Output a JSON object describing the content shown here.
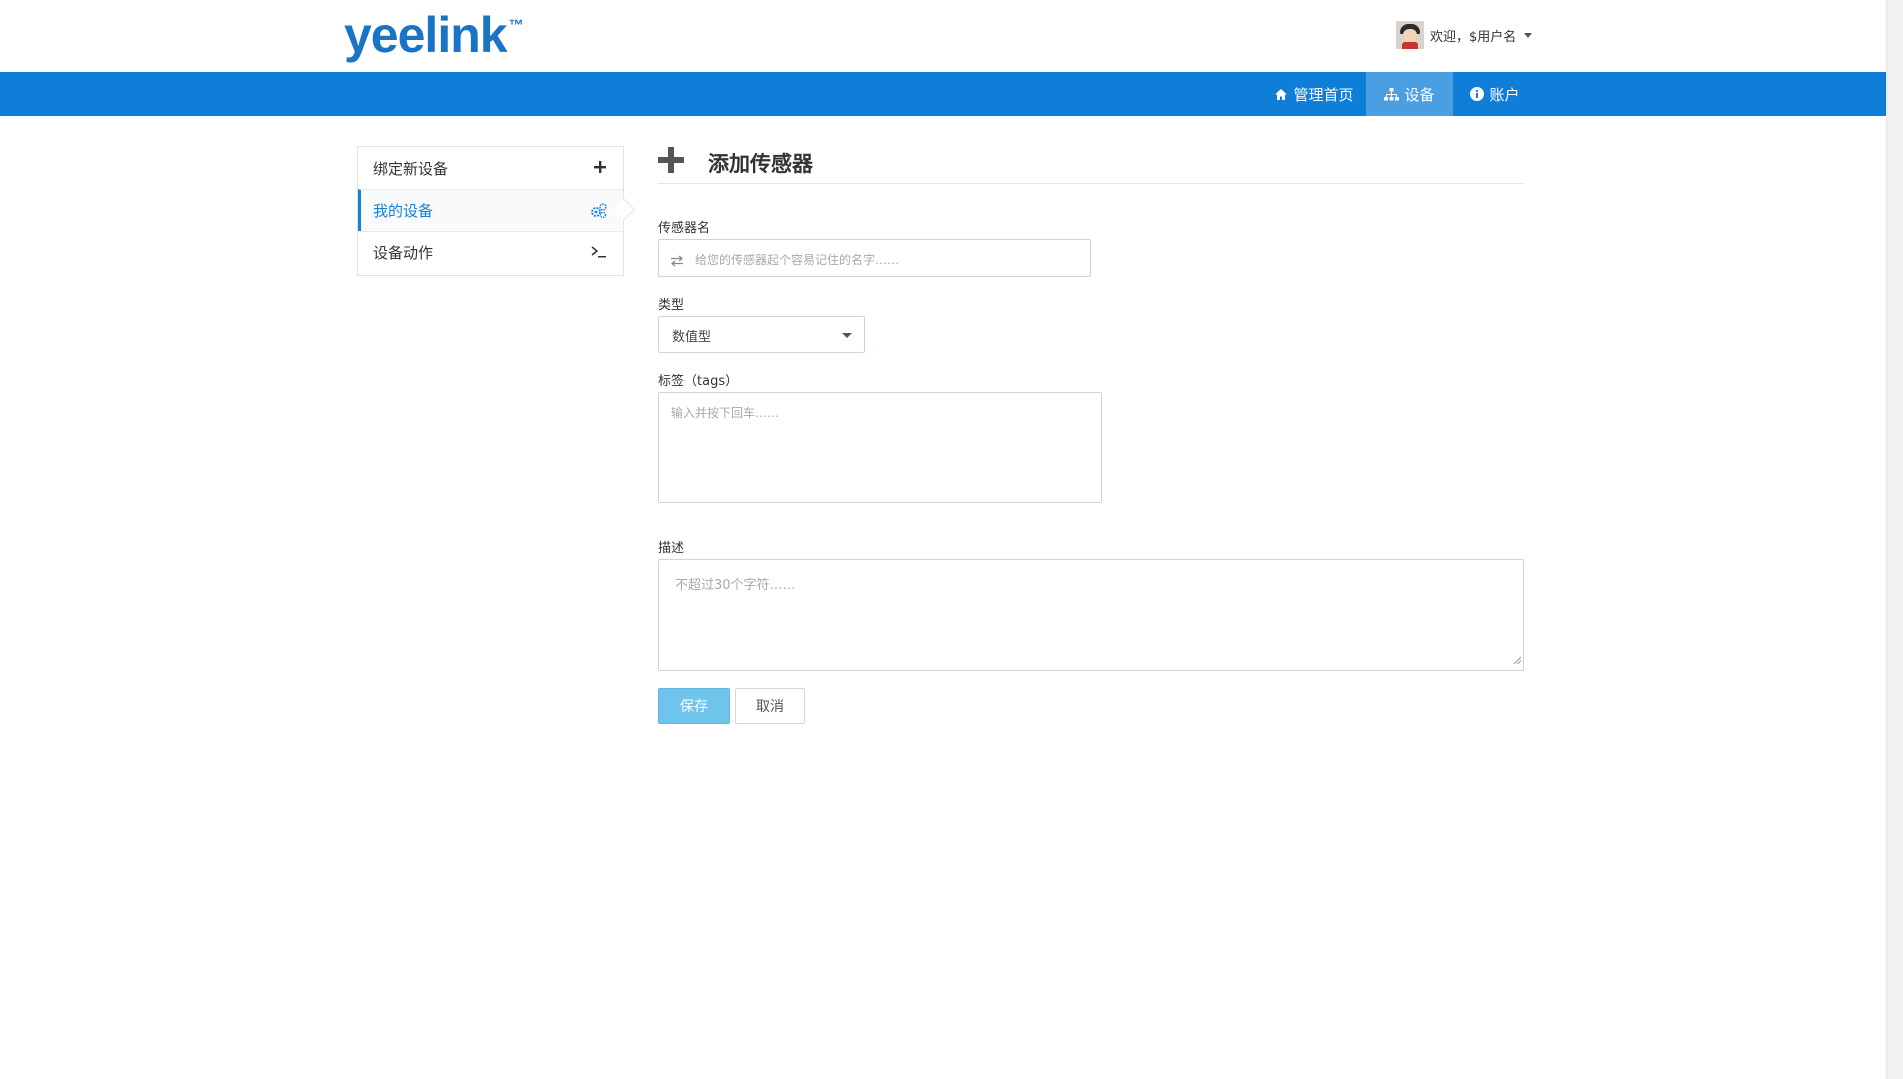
{
  "brand": {
    "name": "yeelink",
    "tm": "™"
  },
  "user": {
    "greeting": "欢迎，$用户名"
  },
  "nav": {
    "items": [
      {
        "label": "管理首页",
        "icon": "home-icon"
      },
      {
        "label": "设备",
        "icon": "sitemap-icon",
        "active": true
      },
      {
        "label": "账户",
        "icon": "info-icon"
      }
    ]
  },
  "sidebar": {
    "items": [
      {
        "label": "绑定新设备",
        "icon": "plus-icon"
      },
      {
        "label": "我的设备",
        "icon": "cogs-icon",
        "active": true
      },
      {
        "label": "设备动作",
        "icon": "terminal-icon"
      }
    ]
  },
  "form": {
    "title": "添加传感器",
    "name_label": "传感器名",
    "name_placeholder": "给您的传感器起个容易记住的名字……",
    "type_label": "类型",
    "type_value": "数值型",
    "tags_label": "标签（tags）",
    "tags_placeholder": "输入并按下回车……",
    "desc_label": "描述",
    "desc_placeholder": "不超过30个字符……",
    "save_label": "保存",
    "cancel_label": "取消"
  },
  "colors": {
    "brand": "#1a74c4",
    "navbar": "#0f7ed9",
    "nav_active": "#4a9fe3",
    "save_button": "#6fc4ec"
  }
}
